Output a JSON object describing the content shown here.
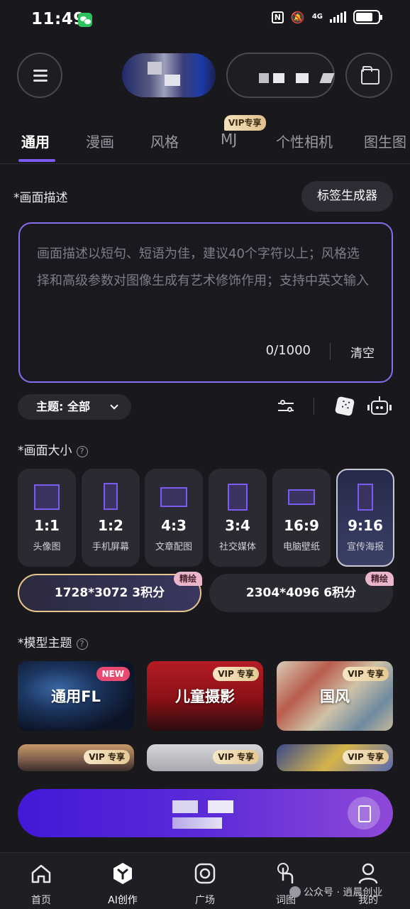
{
  "status_bar": {
    "time": "11:49",
    "network": "4G",
    "nfc": "N"
  },
  "header": {},
  "tabs": [
    {
      "label": "通用",
      "active": true
    },
    {
      "label": "漫画"
    },
    {
      "label": "风格"
    },
    {
      "label": "MJ",
      "badge": "VIP专享"
    },
    {
      "label": "个性相机"
    },
    {
      "label": "图生图"
    }
  ],
  "prompt": {
    "section_label": "*画面描述",
    "tag_generator_label": "标签生成器",
    "placeholder": "画面描述以短句、短语为佳，建议40个字符以上；风格选择和高级参数对图像生成有艺术修饰作用；支持中英文输入",
    "value": "",
    "counter": "0/1000",
    "clear_label": "清空"
  },
  "theme": {
    "label": "主题: 全部"
  },
  "size": {
    "section_label": "*画面大小",
    "help": "?",
    "options": [
      {
        "ratio": "1:1",
        "name": "头像图"
      },
      {
        "ratio": "1:2",
        "name": "手机屏幕"
      },
      {
        "ratio": "4:3",
        "name": "文章配图"
      },
      {
        "ratio": "3:4",
        "name": "社交媒体"
      },
      {
        "ratio": "16:9",
        "name": "电脑壁纸"
      },
      {
        "ratio": "9:16",
        "name": "宣传海报",
        "selected": true
      }
    ],
    "resolutions": [
      {
        "label": "1728*3072 3积分",
        "tag": "精绘",
        "selected": true
      },
      {
        "label": "2304*4096 6积分",
        "tag": "精绘"
      }
    ]
  },
  "model": {
    "section_label": "*模型主题",
    "help": "?",
    "cards": [
      {
        "title": "通用FL",
        "tag": "NEW"
      },
      {
        "title": "儿童摄影",
        "tag": "VIP 专享"
      },
      {
        "title": "国风",
        "tag": "VIP 专享"
      },
      {
        "title": "",
        "tag": "VIP 专享"
      },
      {
        "title": "",
        "tag": "VIP 专享"
      },
      {
        "title": "",
        "tag": "VIP 专享"
      }
    ]
  },
  "bottom_nav": [
    {
      "label": "首页",
      "icon": "home-icon"
    },
    {
      "label": "AI创作",
      "icon": "ai-create-icon",
      "active": true
    },
    {
      "label": "广场",
      "icon": "plaza-icon"
    },
    {
      "label": "词图",
      "icon": "tap-icon"
    },
    {
      "label": "我的",
      "icon": "profile-icon"
    }
  ],
  "watermark": "公众号 · 逍晨创业",
  "colors": {
    "accent": "#7b5af0",
    "background": "#19181d",
    "vip_gold": "#e6c995",
    "generate_start": "#4418d8",
    "generate_end": "#8f48d8"
  }
}
